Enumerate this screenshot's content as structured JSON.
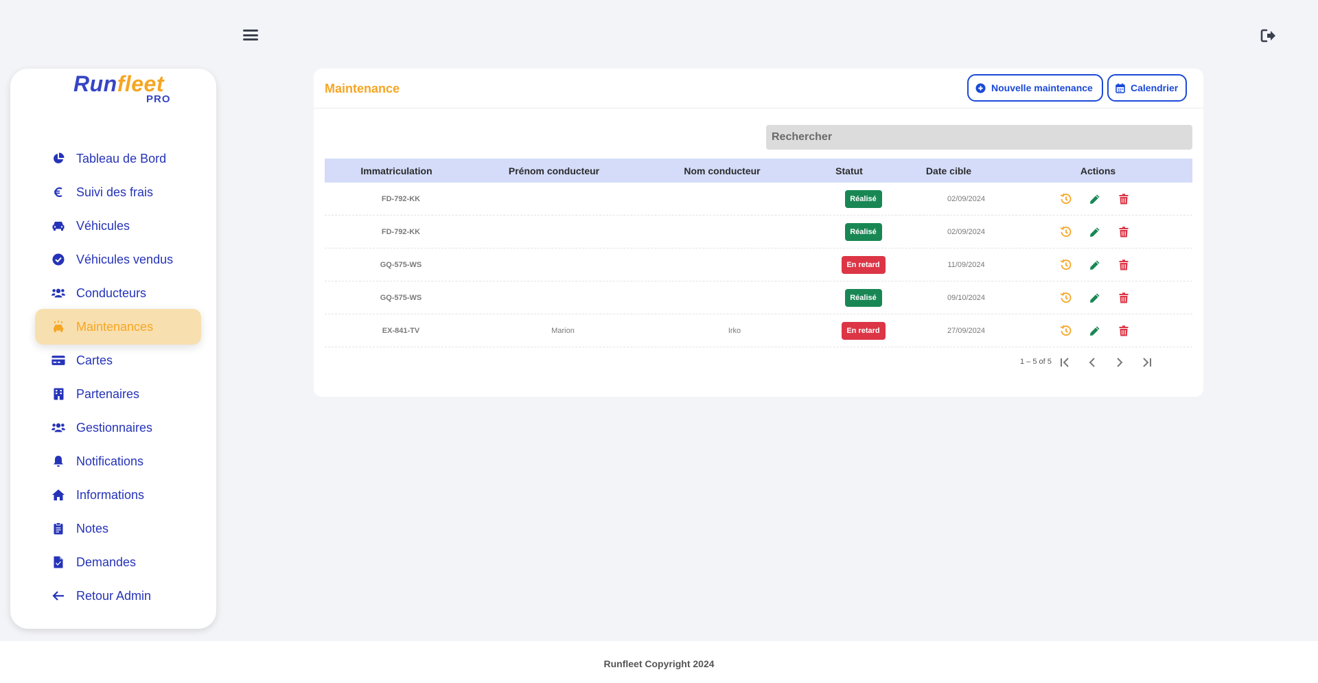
{
  "topbar": {
    "menu_icon": "hamburger-icon",
    "logout_icon": "logout-icon"
  },
  "sidebar": {
    "logo": {
      "run": "Run",
      "fleet": "fleet",
      "pro": "PRO"
    },
    "items": [
      {
        "label": "Tableau de Bord",
        "icon": "chart-pie-icon"
      },
      {
        "label": "Suivi des frais",
        "icon": "euro-icon"
      },
      {
        "label": "Véhicules",
        "icon": "car-icon"
      },
      {
        "label": "Véhicules vendus",
        "icon": "check-circle-icon"
      },
      {
        "label": "Conducteurs",
        "icon": "users-icon"
      },
      {
        "label": "Maintenances",
        "icon": "car-wash-icon",
        "active": true
      },
      {
        "label": "Cartes",
        "icon": "credit-card-icon"
      },
      {
        "label": "Partenaires",
        "icon": "building-icon"
      },
      {
        "label": "Gestionnaires",
        "icon": "users-icon"
      },
      {
        "label": "Notifications",
        "icon": "bell-icon"
      },
      {
        "label": "Informations",
        "icon": "home-icon"
      },
      {
        "label": "Notes",
        "icon": "clipboard-icon"
      },
      {
        "label": "Demandes",
        "icon": "file-icon"
      },
      {
        "label": "Retour Admin",
        "icon": "arrow-left-icon"
      }
    ]
  },
  "card": {
    "title": "Maintenance",
    "new_button": "Nouvelle maintenance",
    "calendar_button": "Calendrier",
    "search_placeholder": "Rechercher"
  },
  "table": {
    "headers": [
      "Immatriculation",
      "Prénom conducteur",
      "Nom conducteur",
      "Statut",
      "Date cible",
      "Actions"
    ],
    "rows": [
      {
        "plate": "FD-792-KK",
        "first": "",
        "last": "",
        "status": "Réalisé",
        "status_type": "ok",
        "date": "02/09/2024"
      },
      {
        "plate": "FD-792-KK",
        "first": "",
        "last": "",
        "status": "Réalisé",
        "status_type": "ok",
        "date": "02/09/2024"
      },
      {
        "plate": "GQ-575-WS",
        "first": "",
        "last": "",
        "status": "En retard",
        "status_type": "late",
        "date": "11/09/2024"
      },
      {
        "plate": "GQ-575-WS",
        "first": "",
        "last": "",
        "status": "Réalisé",
        "status_type": "ok",
        "date": "09/10/2024"
      },
      {
        "plate": "EX-841-TV",
        "first": "Marion",
        "last": "Irko",
        "status": "En retard",
        "status_type": "late",
        "date": "27/09/2024"
      }
    ]
  },
  "pager": {
    "range": "1 – 5 of 5"
  },
  "footer": {
    "text": "Runfleet Copyright 2024"
  },
  "colors": {
    "accent": "#f5a623",
    "primary": "#2533b8",
    "success": "#198754",
    "danger": "#dc3545"
  }
}
